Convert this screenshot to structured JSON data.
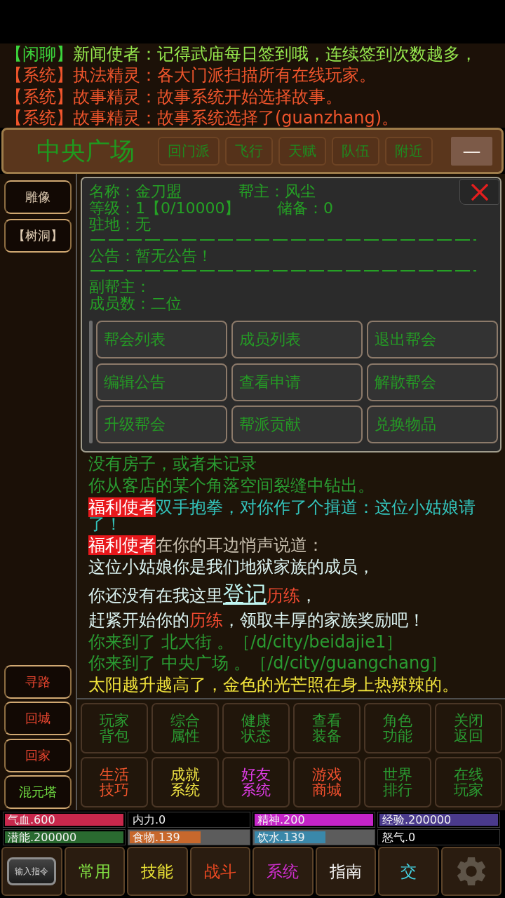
{
  "chat": [
    {
      "kind": "chat",
      "channel": "【闲聊】",
      "text": "新闻使者：记得武庙每日签到哦，连续签到次数越多，"
    },
    {
      "kind": "system",
      "channel": "【系统】",
      "text": "执法精灵：各大门派扫描所有在线玩家。"
    },
    {
      "kind": "system",
      "channel": "【系统】",
      "text": "故事精灵：故事系统开始选择故事。"
    },
    {
      "kind": "system",
      "channel": "【系统】",
      "text": "故事精灵：故事系统选择了(guanzhang)。"
    }
  ],
  "location": {
    "name": "中央广场",
    "actions": [
      "回门派",
      "飞行",
      "天赋",
      "队伍",
      "附近"
    ],
    "collapse": "—"
  },
  "sidebar": {
    "top": [
      {
        "label": "雕像",
        "color": "#e0cdb4"
      },
      {
        "label": "【树洞】",
        "color": "#e0cdb4"
      }
    ],
    "bottom": [
      {
        "label": "寻路",
        "color": "#ea4630"
      },
      {
        "label": "回城",
        "color": "#ea4630"
      },
      {
        "label": "回家",
        "color": "#ea4630"
      },
      {
        "label": "混元塔",
        "color": "#72e244"
      }
    ]
  },
  "guild": {
    "info": [
      [
        "名称：金刀盟",
        "帮主：风尘"
      ],
      [
        "等级：1【0/10000】",
        "储备：0"
      ],
      [
        "驻地：无"
      ]
    ],
    "notice": "公告：暂无公告！",
    "members": [
      "副帮主：",
      "成员数：二位"
    ],
    "actions": [
      "帮会列表",
      "成员列表",
      "退出帮会",
      "编辑公告",
      "查看申请",
      "解散帮会",
      "升级帮会",
      "帮派贡献",
      "兑换物品"
    ]
  },
  "log": [
    {
      "color": "#2a9c32",
      "segments": [
        {
          "kind": "plain",
          "text": "没有房子，或者未记录"
        }
      ]
    },
    {
      "color": "#2a9c32",
      "segments": [
        {
          "kind": "plain",
          "text": "你从客店的某个角落空间裂缝中钻出。"
        }
      ]
    },
    {
      "color": "#33c4bc",
      "segments": [
        {
          "kind": "npc",
          "text": "福利使者"
        },
        {
          "kind": "plain",
          "text": "双手抱拳，对你作了个揖道：这位小姑娘请了！"
        }
      ]
    },
    {
      "color": "#c8bfae",
      "segments": [
        {
          "kind": "npc",
          "text": "福利使者"
        },
        {
          "kind": "plain",
          "text": "在你的耳边悄声说道："
        }
      ]
    },
    {
      "color": "#dcf4f2",
      "segments": [
        {
          "kind": "plain",
          "text": "这位小姑娘你是我们地狱家族的成员，"
        }
      ]
    },
    {
      "color": "#dcf4f2",
      "segments": [
        {
          "kind": "plain",
          "text": "你还没有在我这里"
        },
        {
          "kind": "link",
          "text": "登记"
        },
        {
          "kind": "term",
          "text": "历练"
        },
        {
          "kind": "plain",
          "text": "，"
        }
      ]
    },
    {
      "color": "#dcf4f2",
      "segments": [
        {
          "kind": "plain",
          "text": "赶紧开始你的"
        },
        {
          "kind": "term",
          "text": "历练"
        },
        {
          "kind": "plain",
          "text": "，领取丰厚的家族奖励吧！"
        }
      ]
    },
    {
      "color": "#2a9c32",
      "segments": [
        {
          "kind": "plain",
          "text": "你来到了 北大街 。［/d/city/beidajie1］"
        }
      ]
    },
    {
      "color": "#2a9c32",
      "segments": [
        {
          "kind": "plain",
          "text": "你来到了 中央广场 。［/d/city/guangchang］"
        }
      ]
    },
    {
      "color": "#f2e43c",
      "segments": [
        {
          "kind": "plain",
          "text": "太阳越升越高了，金色的光芒照在身上热辣辣的。"
        }
      ]
    }
  ],
  "menu": [
    {
      "label": "玩家背包",
      "color": "#2a9c32"
    },
    {
      "label": "综合属性",
      "color": "#2a9c32"
    },
    {
      "label": "健康状态",
      "color": "#2a9c32"
    },
    {
      "label": "查看装备",
      "color": "#2a9c32"
    },
    {
      "label": "角色功能",
      "color": "#2a9c32"
    },
    {
      "label": "关闭返回",
      "color": "#2a9c32"
    },
    {
      "label": "生活技巧",
      "color": "#f2562c"
    },
    {
      "label": "成就系统",
      "color": "#f0e444"
    },
    {
      "label": "好友系统",
      "color": "#e03ce8"
    },
    {
      "label": "游戏商城",
      "color": "#f2502e"
    },
    {
      "label": "世界排行",
      "color": "#2a9c32"
    },
    {
      "label": "在线玩家",
      "color": "#2a9c32"
    }
  ],
  "stats": [
    {
      "label": "气血.600",
      "kind": "attribute",
      "level": 1,
      "color": "#c8284c"
    },
    {
      "label": "内力.0",
      "kind": "attribute",
      "level": 0
    },
    {
      "label": "精神.200",
      "kind": "attribute",
      "level": 1,
      "color": "#c424c8"
    },
    {
      "label": "经验.200000",
      "kind": "attribute",
      "level": 1,
      "color": "#4a3a8c"
    },
    {
      "label": "潜能.200000",
      "kind": "attribute",
      "level": 1,
      "color": "#2a6a30"
    },
    {
      "label": "食物.139",
      "kind": "resource",
      "level": 0.6,
      "color": "#c8682c"
    },
    {
      "label": "饮水.139",
      "kind": "resource",
      "level": 0.6,
      "color": "#3a88aa"
    },
    {
      "label": "怒气.0",
      "kind": "attribute",
      "level": 0
    }
  ],
  "toolbar": [
    {
      "kind": "command",
      "label": "输入指令"
    },
    {
      "kind": "tab",
      "label": "常用",
      "color": "#84e444"
    },
    {
      "kind": "tab",
      "label": "技能",
      "color": "#ece436"
    },
    {
      "kind": "tab",
      "label": "战斗",
      "color": "#f04a22"
    },
    {
      "kind": "tab",
      "label": "系统",
      "color": "#d02ed0"
    },
    {
      "kind": "tab",
      "label": "指南",
      "color": "#f4f4f4"
    },
    {
      "kind": "tab",
      "label": "交",
      "color": "#44d4e4"
    },
    {
      "kind": "settings"
    }
  ]
}
